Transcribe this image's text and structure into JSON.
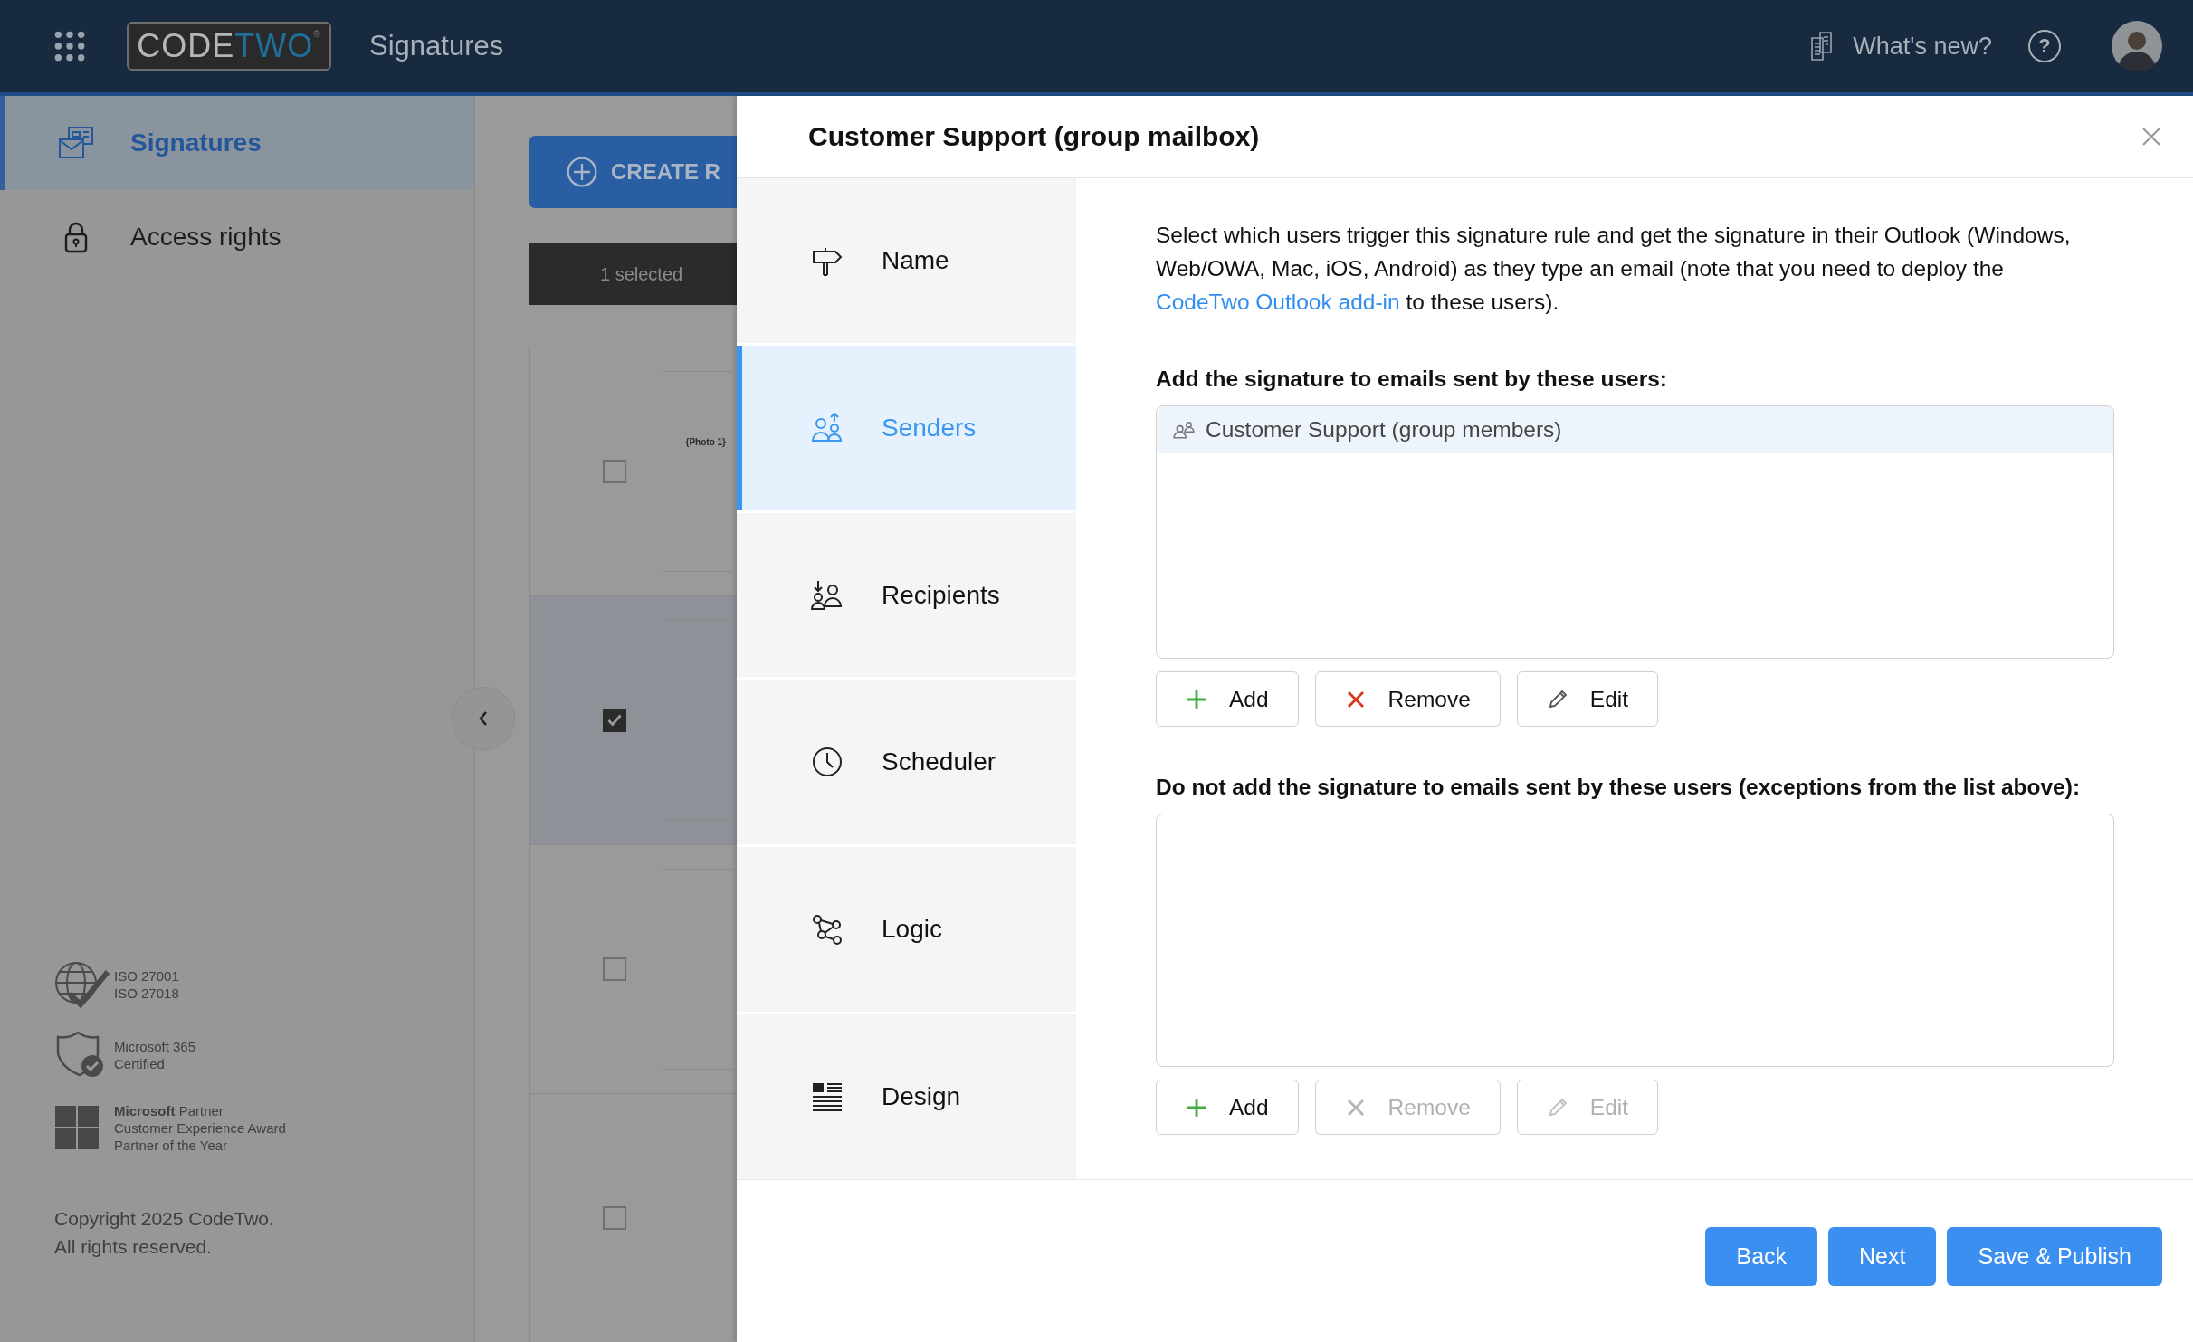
{
  "topbar": {
    "logo": {
      "part1": "CODE",
      "part2": "TWO",
      "mark": "®"
    },
    "app_title": "Signatures",
    "whats_new": "What's new?",
    "help": "?"
  },
  "sidebar": {
    "items": [
      {
        "label": "Signatures",
        "selected": true
      },
      {
        "label": "Access rights",
        "selected": false
      }
    ],
    "badges": [
      {
        "kind": "iso",
        "lines": [
          "ISO 27001",
          "ISO 27018"
        ]
      },
      {
        "kind": "m365",
        "lines": [
          "Microsoft 365",
          "Certified"
        ]
      },
      {
        "kind": "partner",
        "lines": [
          "**Microsoft** Partner",
          "Customer Experience Award",
          "Partner of the Year"
        ]
      }
    ],
    "copyright": [
      "Copyright 2025 CodeTwo.",
      "All rights reserved."
    ]
  },
  "content": {
    "create_button": "CREATE R",
    "selection_bar": "1 selected",
    "rows": [
      {
        "checked": false,
        "selected": false,
        "thumbnail": "{Photo 1}"
      },
      {
        "checked": true,
        "selected": true
      },
      {
        "checked": false,
        "selected": false
      },
      {
        "checked": false,
        "selected": false
      }
    ]
  },
  "dialog": {
    "title": "Customer Support (group mailbox)",
    "nav": [
      {
        "label": "Name",
        "selected": false
      },
      {
        "label": "Senders",
        "selected": true
      },
      {
        "label": "Recipients",
        "selected": false
      },
      {
        "label": "Scheduler",
        "selected": false
      },
      {
        "label": "Logic",
        "selected": false
      },
      {
        "label": "Design",
        "selected": false
      }
    ],
    "intro": {
      "before": "Select which users trigger this signature rule and get the signature in their Outlook (Windows, Web/OWA, Mac, iOS, Android) as they type an email (note that you need to deploy the",
      "link": "CodeTwo Outlook add-in",
      "after": "to these users)."
    },
    "lists": [
      {
        "heading": "Add the signature to emails sent by these users:",
        "entries": [
          {
            "label": "Customer Support (group members)",
            "selected": true
          }
        ],
        "buttons": [
          {
            "kind": "add",
            "label": "Add",
            "disabled": false
          },
          {
            "kind": "remove",
            "label": "Remove",
            "disabled": false
          },
          {
            "kind": "edit",
            "label": "Edit",
            "disabled": false
          }
        ]
      },
      {
        "heading": "Do not add the signature to emails sent by these users (exceptions from the list above):",
        "buttons": [
          {
            "kind": "add",
            "label": "Add",
            "disabled": false
          },
          {
            "kind": "remove",
            "label": "Remove",
            "disabled": true
          },
          {
            "kind": "edit",
            "label": "Edit",
            "disabled": true
          }
        ]
      }
    ],
    "footer_buttons": [
      "Back",
      "Next",
      "Save & Publish"
    ]
  }
}
